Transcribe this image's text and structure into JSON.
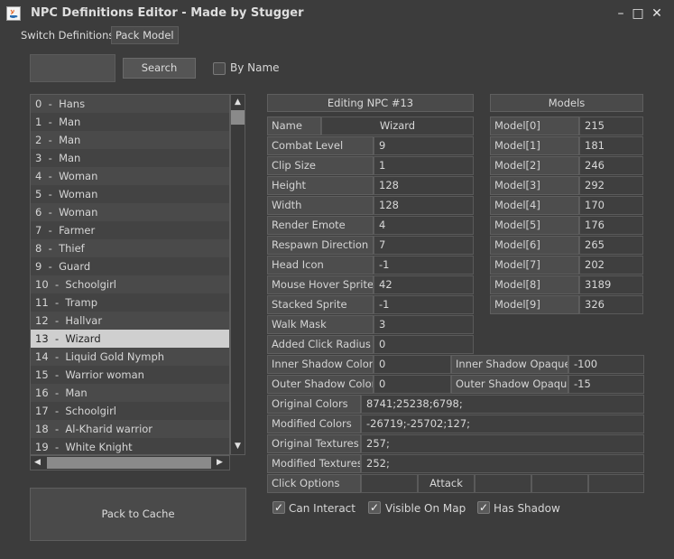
{
  "window": {
    "title": "NPC Definitions Editor - Made by Stugger",
    "icon": "java-icon"
  },
  "menu": {
    "switch": "Switch Definitions",
    "pack_model": "Pack Model"
  },
  "search": {
    "value": "",
    "button": "Search",
    "by_name": "By Name",
    "by_name_checked": false
  },
  "npc_list": [
    "0  -  Hans",
    "1  -  Man",
    "2  -  Man",
    "3  -  Man",
    "4  -  Woman",
    "5  -  Woman",
    "6  -  Woman",
    "7  -  Farmer",
    "8  -  Thief",
    "9  -  Guard",
    "10  -  Schoolgirl",
    "11  -  Tramp",
    "12  -  Hallvar",
    "13  -  Wizard",
    "14  -  Liquid Gold Nymph",
    "15  -  Warrior woman",
    "16  -  Man",
    "17  -  Schoolgirl",
    "18  -  Al-Kharid warrior",
    "19  -  White Knight"
  ],
  "selected_index": 13,
  "pack_to_cache": "Pack to Cache",
  "editor": {
    "header": "Editing NPC #13",
    "name_label": "Name",
    "name_value": "Wizard",
    "fields": [
      {
        "label": "Combat Level",
        "value": "9"
      },
      {
        "label": "Clip Size",
        "value": "1"
      },
      {
        "label": "Height",
        "value": "128"
      },
      {
        "label": "Width",
        "value": "128"
      },
      {
        "label": "Render Emote",
        "value": "4"
      },
      {
        "label": "Respawn Direction",
        "value": "7"
      },
      {
        "label": "Head Icon",
        "value": "-1"
      },
      {
        "label": "Mouse Hover Sprite",
        "value": "42"
      },
      {
        "label": "Stacked Sprite",
        "value": "-1"
      },
      {
        "label": "Walk Mask",
        "value": "3"
      },
      {
        "label": "Added Click Radius",
        "value": "0"
      }
    ],
    "inner_shadow_color": {
      "label": "Inner Shadow Color",
      "value": "0"
    },
    "inner_shadow_opaque": {
      "label": "Inner Shadow Opaque",
      "value": "-100"
    },
    "outer_shadow_color": {
      "label": "Outer Shadow Color",
      "value": "0"
    },
    "outer_shadow_opaque": {
      "label": "Outer Shadow Opaque",
      "value": "-15"
    },
    "original_colors": {
      "label": "Original Colors",
      "value": "8741;25238;6798;"
    },
    "modified_colors": {
      "label": "Modified Colors",
      "value": "-26719;-25702;127;"
    },
    "original_textures": {
      "label": "Original Textures",
      "value": "257;"
    },
    "modified_textures": {
      "label": "Modified Textures",
      "value": "252;"
    },
    "click_options": {
      "label": "Click Options",
      "values": [
        "",
        "Attack",
        "",
        "",
        ""
      ]
    },
    "checks": [
      {
        "label": "Can Interact",
        "checked": true
      },
      {
        "label": "Visible On Map",
        "checked": true
      },
      {
        "label": "Has Shadow",
        "checked": true
      }
    ]
  },
  "models": {
    "header": "Models",
    "items": [
      {
        "label": "Model[0]",
        "value": "215"
      },
      {
        "label": "Model[1]",
        "value": "181"
      },
      {
        "label": "Model[2]",
        "value": "246"
      },
      {
        "label": "Model[3]",
        "value": "292"
      },
      {
        "label": "Model[4]",
        "value": "170"
      },
      {
        "label": "Model[5]",
        "value": "176"
      },
      {
        "label": "Model[6]",
        "value": "265"
      },
      {
        "label": "Model[7]",
        "value": "202"
      },
      {
        "label": "Model[8]",
        "value": "3189"
      },
      {
        "label": "Model[9]",
        "value": "326"
      }
    ]
  }
}
